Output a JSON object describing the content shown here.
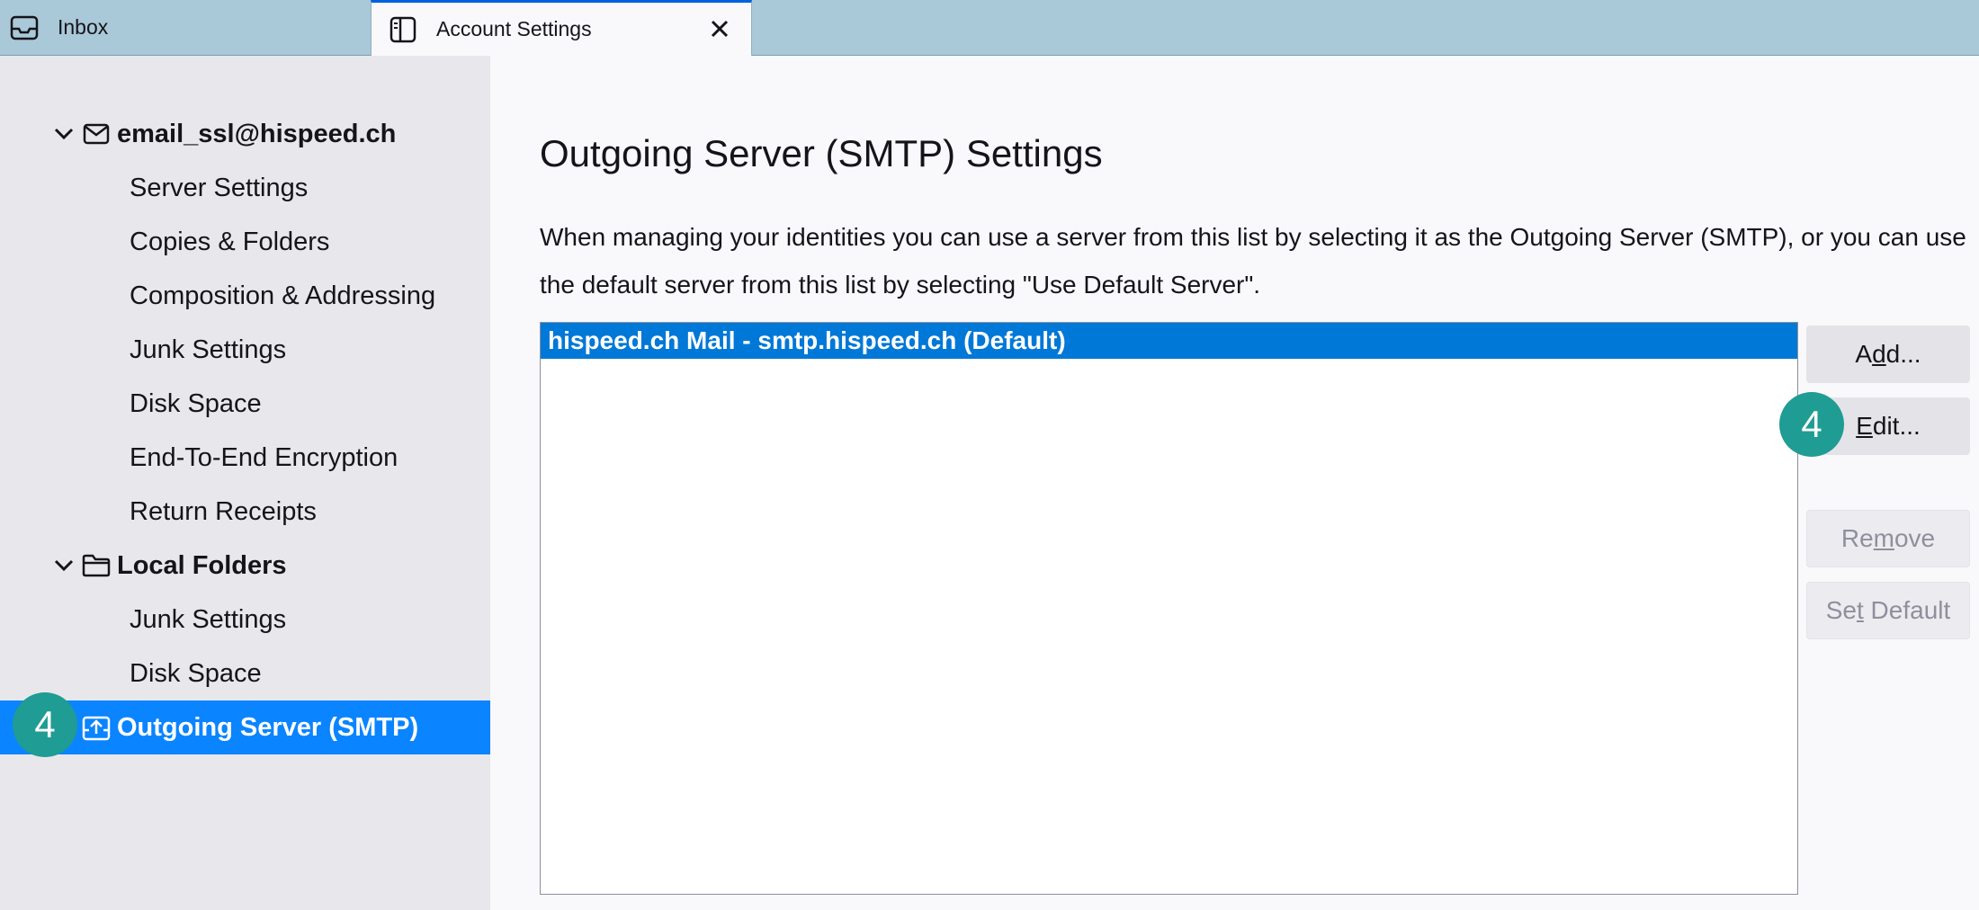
{
  "tabs": [
    {
      "label": "Inbox",
      "icon": "inbox-icon",
      "active": false
    },
    {
      "label": "Account Settings",
      "icon": "account-settings-icon",
      "active": true,
      "close_icon": "close-icon"
    }
  ],
  "sidebar": {
    "accounts": [
      {
        "label": "email_ssl@hispeed.ch",
        "icon": "envelope-icon",
        "expanded": true,
        "items": [
          {
            "label": "Server Settings"
          },
          {
            "label": "Copies & Folders"
          },
          {
            "label": "Composition & Addressing"
          },
          {
            "label": "Junk Settings"
          },
          {
            "label": "Disk Space"
          },
          {
            "label": "End-To-End Encryption"
          },
          {
            "label": "Return Receipts"
          }
        ]
      },
      {
        "label": "Local Folders",
        "icon": "folder-icon",
        "expanded": true,
        "items": [
          {
            "label": "Junk Settings"
          },
          {
            "label": "Disk Space"
          }
        ]
      }
    ],
    "outgoing": {
      "label": "Outgoing Server (SMTP)",
      "icon": "outgoing-server-icon",
      "selected": true
    }
  },
  "main": {
    "title": "Outgoing Server (SMTP) Settings",
    "description": "When managing your identities you can use a server from this list by selecting it as the Outgoing Server (SMTP), or you can use the default server from this list by selecting \"Use Default Server\".",
    "servers": [
      {
        "label": "hispeed.ch Mail - smtp.hispeed.ch (Default)",
        "selected": true
      }
    ],
    "buttons": {
      "add": {
        "label": "Add...",
        "access_key": "d"
      },
      "edit": {
        "label": "Edit...",
        "access_key": "E"
      },
      "remove": {
        "label": "Remove",
        "access_key": "m",
        "disabled": true
      },
      "set_default": {
        "label": "Set Default",
        "access_key": "t",
        "disabled": true
      }
    }
  },
  "callouts": [
    {
      "label": "4",
      "target": "sidebar-outgoing-server"
    },
    {
      "label": "4",
      "target": "edit-button"
    }
  ],
  "colors": {
    "tabbar": "#a9c8d8",
    "sidebar": "#e8e8ec",
    "selection": "#0a84ff",
    "list_selection": "#0078d7",
    "callout": "#1f9c93",
    "active_tab_indicator": "#0061e0"
  }
}
